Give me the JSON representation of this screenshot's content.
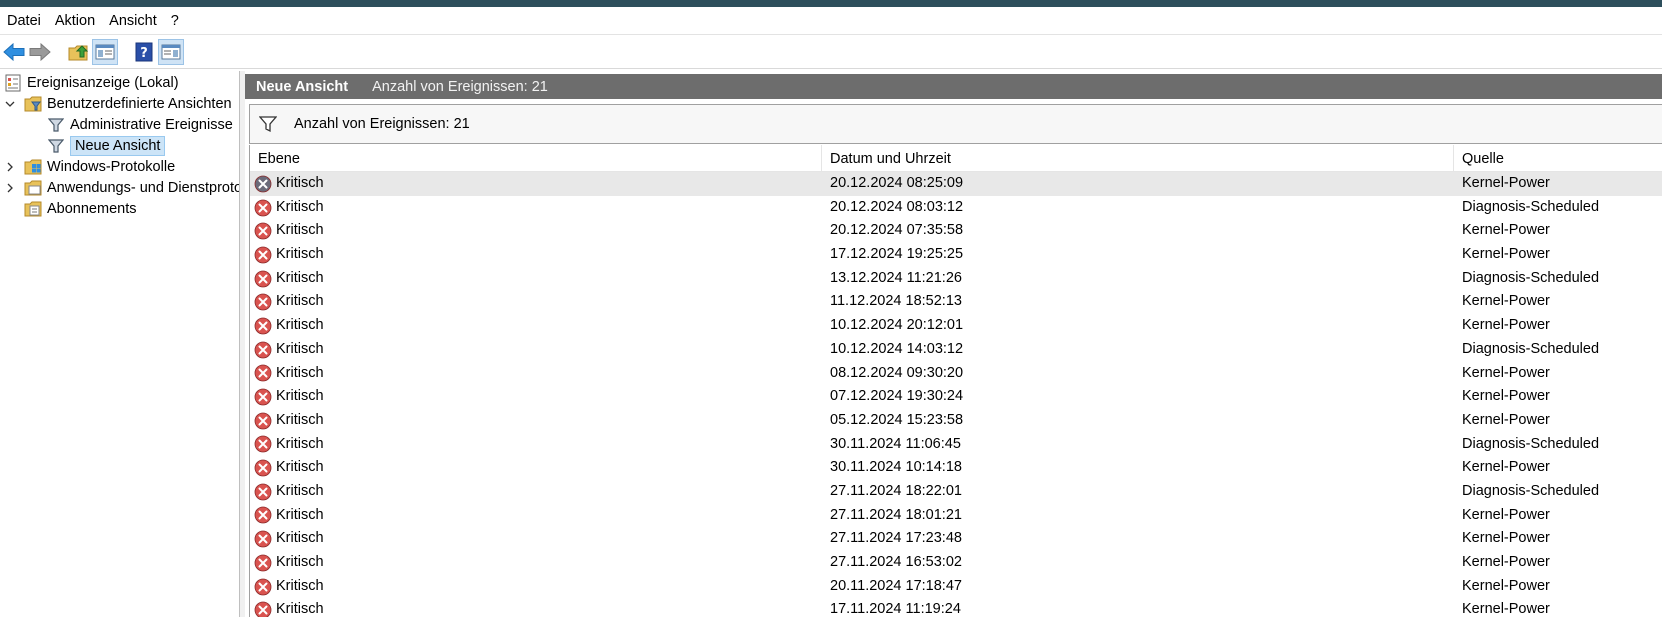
{
  "menu": [
    "Datei",
    "Aktion",
    "Ansicht",
    "?"
  ],
  "toolbar": {
    "icons": [
      "back-arrow-icon",
      "forward-arrow-icon",
      "up-folder-icon",
      "show-hide-console-tree-icon",
      "help-icon",
      "show-hide-action-pane-icon"
    ]
  },
  "tree": {
    "root": "Ereignisanzeige (Lokal)",
    "custom_views": "Benutzerdefinierte Ansichten",
    "admin_events": "Administrative Ereignisse",
    "new_view": "Neue Ansicht",
    "windows_logs": "Windows-Protokolle",
    "app_service_logs": "Anwendungs- und Dienstprotokolle",
    "subscriptions": "Abonnements"
  },
  "panel": {
    "title": "Neue Ansicht",
    "count_label": "Anzahl von Ereignissen: 21",
    "filter_text": "Anzahl von Ereignissen: 21"
  },
  "columns": {
    "level": "Ebene",
    "date": "Datum und Uhrzeit",
    "source": "Quelle"
  },
  "events": [
    {
      "level": "Kritisch",
      "date": "20.12.2024 08:25:09",
      "source": "Kernel-Power"
    },
    {
      "level": "Kritisch",
      "date": "20.12.2024 08:03:12",
      "source": "Diagnosis-Scheduled"
    },
    {
      "level": "Kritisch",
      "date": "20.12.2024 07:35:58",
      "source": "Kernel-Power"
    },
    {
      "level": "Kritisch",
      "date": "17.12.2024 19:25:25",
      "source": "Kernel-Power"
    },
    {
      "level": "Kritisch",
      "date": "13.12.2024 11:21:26",
      "source": "Diagnosis-Scheduled"
    },
    {
      "level": "Kritisch",
      "date": "11.12.2024 18:52:13",
      "source": "Kernel-Power"
    },
    {
      "level": "Kritisch",
      "date": "10.12.2024 20:12:01",
      "source": "Kernel-Power"
    },
    {
      "level": "Kritisch",
      "date": "10.12.2024 14:03:12",
      "source": "Diagnosis-Scheduled"
    },
    {
      "level": "Kritisch",
      "date": "08.12.2024 09:30:20",
      "source": "Kernel-Power"
    },
    {
      "level": "Kritisch",
      "date": "07.12.2024 19:30:24",
      "source": "Kernel-Power"
    },
    {
      "level": "Kritisch",
      "date": "05.12.2024 15:23:58",
      "source": "Kernel-Power"
    },
    {
      "level": "Kritisch",
      "date": "30.11.2024 11:06:45",
      "source": "Diagnosis-Scheduled"
    },
    {
      "level": "Kritisch",
      "date": "30.11.2024 10:14:18",
      "source": "Kernel-Power"
    },
    {
      "level": "Kritisch",
      "date": "27.11.2024 18:22:01",
      "source": "Diagnosis-Scheduled"
    },
    {
      "level": "Kritisch",
      "date": "27.11.2024 18:01:21",
      "source": "Kernel-Power"
    },
    {
      "level": "Kritisch",
      "date": "27.11.2024 17:23:48",
      "source": "Kernel-Power"
    },
    {
      "level": "Kritisch",
      "date": "27.11.2024 16:53:02",
      "source": "Kernel-Power"
    },
    {
      "level": "Kritisch",
      "date": "20.11.2024 17:18:47",
      "source": "Kernel-Power"
    },
    {
      "level": "Kritisch",
      "date": "17.11.2024 11:19:24",
      "source": "Kernel-Power"
    }
  ],
  "colors": {
    "header_bar": "#6d6d6d",
    "selection": "#cce4f7",
    "critical": "#d9534f",
    "title_bar": "#2d4f5c"
  }
}
